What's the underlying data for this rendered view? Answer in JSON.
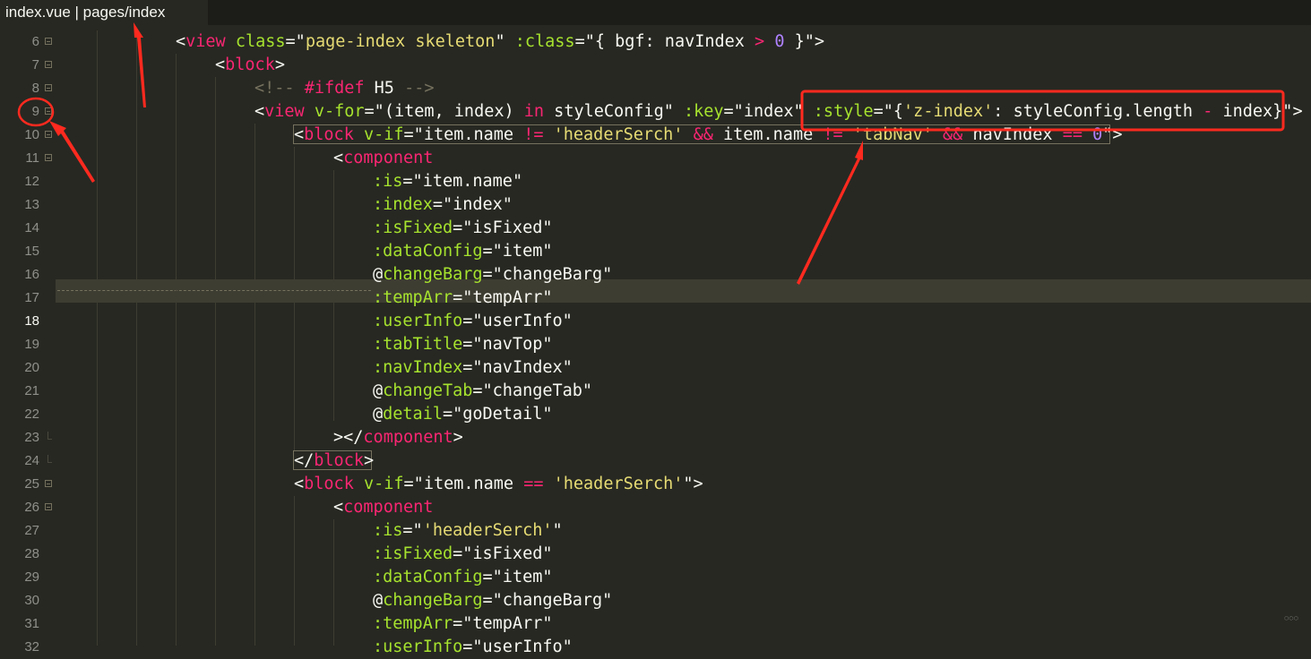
{
  "tab": {
    "title": "index.vue | pages/index"
  },
  "gutter": {
    "line_numbers": [
      "6",
      "7",
      "8",
      "9",
      "10",
      "11",
      "12",
      "13",
      "14",
      "15",
      "16",
      "17",
      "18",
      "19",
      "20",
      "21",
      "22",
      "23",
      "24",
      "25",
      "26",
      "27",
      "28",
      "29",
      "30",
      "31",
      "32"
    ]
  },
  "editor": {
    "active_line": "18",
    "lines": [
      [
        [
          "t",
          "<"
        ],
        [
          "tag",
          "view"
        ],
        [
          "t",
          " "
        ],
        [
          "attr",
          "class"
        ],
        [
          "t",
          "=\""
        ],
        [
          "str",
          "page-index skeleton"
        ],
        [
          "t",
          "\" "
        ],
        [
          "attr",
          ":class"
        ],
        [
          "t",
          "=\"{ bgf: navIndex "
        ],
        [
          "op",
          ">"
        ],
        [
          "t",
          " "
        ],
        [
          "num",
          "0"
        ],
        [
          "t",
          " }\">"
        ]
      ],
      [
        [
          "t",
          "<"
        ],
        [
          "tag",
          "block"
        ],
        [
          "t",
          ">"
        ]
      ],
      [
        [
          "cmt",
          "<!-- "
        ],
        [
          "op",
          "#ifdef"
        ],
        [
          "t",
          " H5 "
        ],
        [
          "cmt",
          "-->"
        ]
      ],
      [
        [
          "t",
          "<"
        ],
        [
          "tag",
          "view"
        ],
        [
          "t",
          " "
        ],
        [
          "attr",
          "v-for"
        ],
        [
          "t",
          "=\"(item, index) "
        ],
        [
          "kw",
          "in"
        ],
        [
          "t",
          " styleConfig\" "
        ],
        [
          "attr",
          ":key"
        ],
        [
          "t",
          "=\"index\" "
        ],
        [
          "attr",
          ":style"
        ],
        [
          "t",
          "=\"{"
        ],
        [
          "str",
          "'z-index'"
        ],
        [
          "t",
          ": styleConfig.length "
        ],
        [
          "op",
          "-"
        ],
        [
          "t",
          " index}\">"
        ]
      ],
      [
        [
          "t",
          "<"
        ],
        [
          "tag",
          "block"
        ],
        [
          "t",
          " "
        ],
        [
          "attr",
          "v-if"
        ],
        [
          "t",
          "=\"item.name "
        ],
        [
          "op",
          "!="
        ],
        [
          "t",
          " "
        ],
        [
          "str",
          "'headerSerch'"
        ],
        [
          "t",
          " "
        ],
        [
          "op",
          "&&"
        ],
        [
          "t",
          " item.name "
        ],
        [
          "op",
          "!="
        ],
        [
          "t",
          " "
        ],
        [
          "str",
          "'tabNav'"
        ],
        [
          "t",
          " "
        ],
        [
          "op",
          "&&"
        ],
        [
          "t",
          " navIndex "
        ],
        [
          "op",
          "=="
        ],
        [
          "t",
          " "
        ],
        [
          "num",
          "0"
        ],
        [
          "t",
          "\">"
        ]
      ],
      [
        [
          "t",
          "<"
        ],
        [
          "tag",
          "component"
        ]
      ],
      [
        [
          "attr",
          ":is"
        ],
        [
          "t",
          "=\"item.name\""
        ]
      ],
      [
        [
          "attr",
          ":index"
        ],
        [
          "t",
          "=\"index\""
        ]
      ],
      [
        [
          "attr",
          ":isFixed"
        ],
        [
          "t",
          "=\"isFixed\""
        ]
      ],
      [
        [
          "attr",
          ":dataConfig"
        ],
        [
          "t",
          "=\"item\""
        ]
      ],
      [
        [
          "t",
          "@"
        ],
        [
          "attr",
          "changeBarg"
        ],
        [
          "t",
          "=\"changeBarg\""
        ]
      ],
      [
        [
          "attr",
          ":tempArr"
        ],
        [
          "t",
          "=\"tempArr\""
        ]
      ],
      [
        [
          "attr",
          ":userInfo"
        ],
        [
          "t",
          "=\"userInfo\""
        ]
      ],
      [
        [
          "attr",
          ":tabTitle"
        ],
        [
          "t",
          "=\"navTop\""
        ]
      ],
      [
        [
          "attr",
          ":navIndex"
        ],
        [
          "t",
          "=\"navIndex\""
        ]
      ],
      [
        [
          "t",
          "@"
        ],
        [
          "attr",
          "changeTab"
        ],
        [
          "t",
          "=\"changeTab\""
        ]
      ],
      [
        [
          "t",
          "@"
        ],
        [
          "attr",
          "detail"
        ],
        [
          "t",
          "=\"goDetail\""
        ]
      ],
      [
        [
          "t",
          "></"
        ],
        [
          "tag",
          "component"
        ],
        [
          "t",
          ">"
        ]
      ],
      [
        [
          "t",
          "</"
        ],
        [
          "tag",
          "block"
        ],
        [
          "t",
          ">"
        ]
      ],
      [
        [
          "t",
          "<"
        ],
        [
          "tag",
          "block"
        ],
        [
          "t",
          " "
        ],
        [
          "attr",
          "v-if"
        ],
        [
          "t",
          "=\"item.name "
        ],
        [
          "op",
          "=="
        ],
        [
          "t",
          " "
        ],
        [
          "str",
          "'headerSerch'"
        ],
        [
          "t",
          "\">"
        ]
      ],
      [
        [
          "t",
          "<"
        ],
        [
          "tag",
          "component"
        ]
      ],
      [
        [
          "attr",
          ":is"
        ],
        [
          "t",
          "=\""
        ],
        [
          "str",
          "'headerSerch'"
        ],
        [
          "t",
          "\""
        ]
      ],
      [
        [
          "attr",
          ":isFixed"
        ],
        [
          "t",
          "=\"isFixed\""
        ]
      ],
      [
        [
          "attr",
          ":dataConfig"
        ],
        [
          "t",
          "=\"item\""
        ]
      ],
      [
        [
          "t",
          "@"
        ],
        [
          "attr",
          "changeBarg"
        ],
        [
          "t",
          "=\"changeBarg\""
        ]
      ],
      [
        [
          "attr",
          ":tempArr"
        ],
        [
          "t",
          "=\"tempArr\""
        ]
      ],
      [
        [
          "attr",
          ":userInfo"
        ],
        [
          "t",
          "=\"userInfo\""
        ]
      ]
    ]
  },
  "colors": {
    "background": "#272822",
    "tag": "#f92672",
    "attribute": "#a6e22e",
    "string": "#e6db74",
    "number": "#ae81ff",
    "comment": "#75715e",
    "annotation_red": "#ff2a1f"
  }
}
